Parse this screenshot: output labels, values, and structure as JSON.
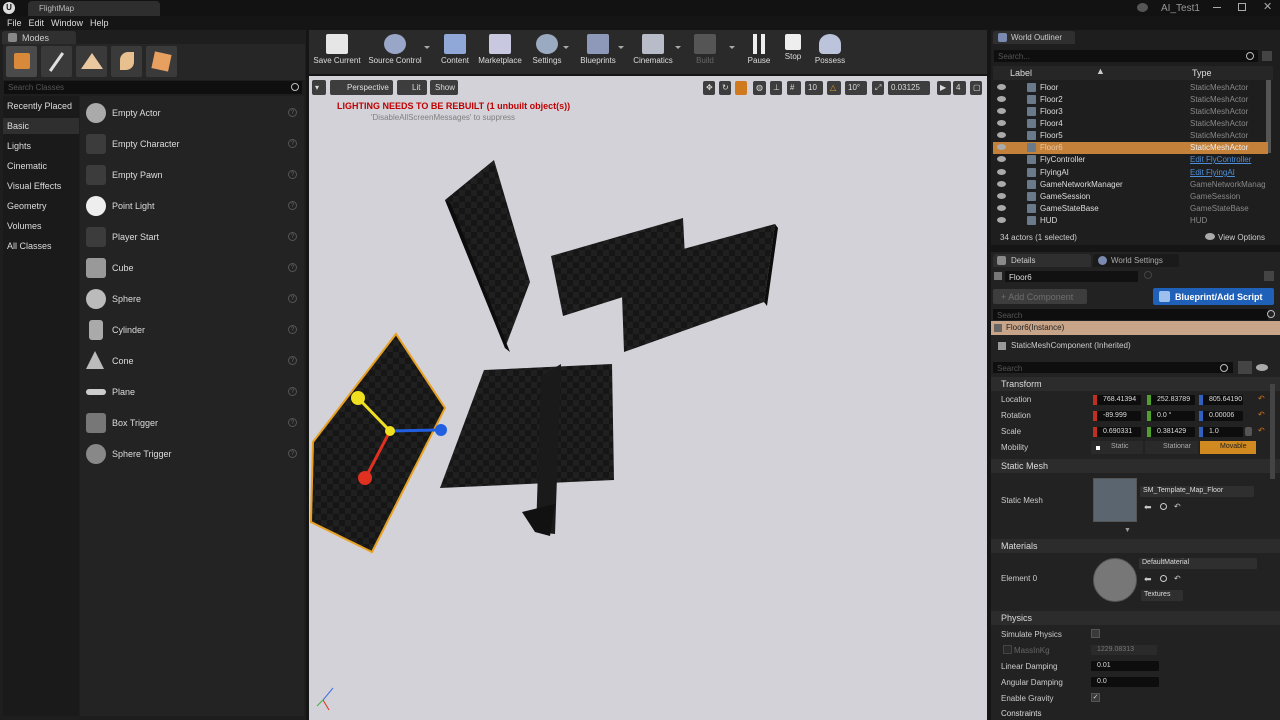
{
  "app": {
    "logo": "U",
    "document_tab": "FlightMap",
    "project": "AI_Test1"
  },
  "menu": [
    "File",
    "Edit",
    "Window",
    "Help"
  ],
  "modes": {
    "tab": "Modes",
    "search_placeholder": "Search Classes",
    "categories": [
      "Recently Placed",
      "Basic",
      "Lights",
      "Cinematic",
      "Visual Effects",
      "Geometry",
      "Volumes",
      "All Classes"
    ],
    "active_category": "Basic",
    "classes": [
      "Empty Actor",
      "Empty Character",
      "Empty Pawn",
      "Point Light",
      "Player Start",
      "Cube",
      "Sphere",
      "Cylinder",
      "Cone",
      "Plane",
      "Box Trigger",
      "Sphere Trigger"
    ]
  },
  "toolbar": {
    "buttons": [
      "Save Current",
      "Source Control",
      "Content",
      "Marketplace",
      "Settings",
      "Blueprints",
      "Cinematics",
      "Build",
      "Pause",
      "Stop",
      "Possess"
    ]
  },
  "viewport": {
    "perspective": "Perspective",
    "lit": "Lit",
    "show": "Show",
    "grid_snap": "10",
    "rotation_snap": "10°",
    "scale_snap": "0.03125",
    "camera_speed": "4",
    "lighting_warning": "LIGHTING NEEDS TO BE REBUILT (1 unbuilt object(s))",
    "lighting_hint": "'DisableAllScreenMessages' to suppress"
  },
  "outliner": {
    "tab": "World Outliner",
    "search_placeholder": "Search...",
    "col_label": "Label",
    "col_type": "Type",
    "rows": [
      {
        "label": "Floor",
        "type": "StaticMeshActor"
      },
      {
        "label": "Floor2",
        "type": "StaticMeshActor"
      },
      {
        "label": "Floor3",
        "type": "StaticMeshActor"
      },
      {
        "label": "Floor4",
        "type": "StaticMeshActor"
      },
      {
        "label": "Floor5",
        "type": "StaticMeshActor"
      },
      {
        "label": "Floor6",
        "type": "StaticMeshActor"
      },
      {
        "label": "FlyController",
        "type": "Edit FlyController"
      },
      {
        "label": "FlyingAI",
        "type": "Edit FlyingAI"
      },
      {
        "label": "GameNetworkManager",
        "type": "GameNetworkManag"
      },
      {
        "label": "GameSession",
        "type": "GameSession"
      },
      {
        "label": "GameStateBase",
        "type": "GameStateBase"
      },
      {
        "label": "HUD",
        "type": "HUD"
      }
    ],
    "footer": "34 actors (1 selected)",
    "view_options": "View Options"
  },
  "details": {
    "tab": "Details",
    "tab2": "World Settings",
    "object_name": "Floor6",
    "add_component": "+ Add Component",
    "blueprint_button": "Blueprint/Add Script",
    "search_placeholder": "Search",
    "instance": "Floor6(Instance)",
    "component": "StaticMeshComponent (Inherited)",
    "search2_placeholder": "Search",
    "transform": {
      "title": "Transform",
      "location_label": "Location",
      "rotation_label": "Rotation",
      "scale_label": "Scale",
      "mobility_label": "Mobility",
      "location": [
        "768.41394",
        "252.83789",
        "805.64190"
      ],
      "rotation": [
        "-89.999",
        "0.0 °",
        "0.00006"
      ],
      "scale": [
        "0.690331",
        "0.381429",
        "1.0"
      ],
      "mobility": [
        "Static",
        "Stationar",
        "Movable"
      ]
    },
    "static_mesh": {
      "title": "Static Mesh",
      "label": "Static Mesh",
      "value": "SM_Template_Map_Floor"
    },
    "materials": {
      "title": "Materials",
      "label": "Element 0",
      "value": "DefaultMaterial",
      "textures": "Textures"
    },
    "physics": {
      "title": "Physics",
      "simulate": "Simulate Physics",
      "mass_label": "MassInKg",
      "mass": "1229.08313",
      "linear_label": "Linear Damping",
      "linear": "0.01",
      "angular_label": "Angular Damping",
      "angular": "0.0",
      "gravity": "Enable Gravity"
    },
    "constraints": "Constraints"
  },
  "colors": {
    "selection": "#c4813a",
    "accent_blue": "#1f60b8",
    "warning": "#c00000"
  }
}
